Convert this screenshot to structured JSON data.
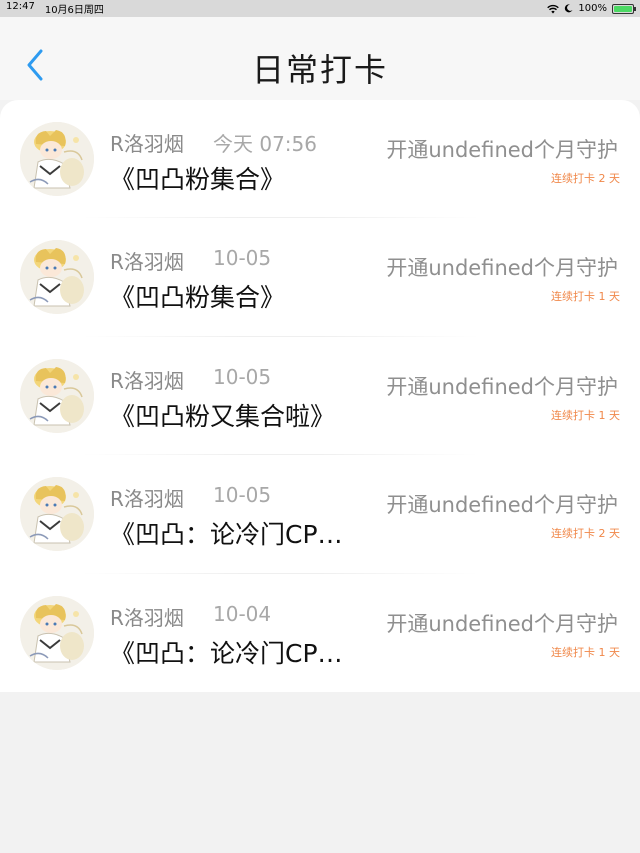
{
  "status_bar": {
    "time": "12:47",
    "date": "10月6日周四",
    "battery": "100%",
    "battery_level": 1.0
  },
  "header": {
    "title": "日常打卡"
  },
  "records": [
    {
      "name": "R洛羽烟",
      "time": "今天 07:56",
      "title": "《凹凸粉集合》",
      "guard": "开通undefined个月守护",
      "streak": "连续打卡 2 天"
    },
    {
      "name": "R洛羽烟",
      "time": "10-05",
      "title": "《凹凸粉集合》",
      "guard": "开通undefined个月守护",
      "streak": "连续打卡 1 天"
    },
    {
      "name": "R洛羽烟",
      "time": "10-05",
      "title": "《凹凸粉又集合啦》",
      "guard": "开通undefined个月守护",
      "streak": "连续打卡 1 天"
    },
    {
      "name": "R洛羽烟",
      "time": "10-05",
      "title": "《凹凸：论冷门CP…",
      "guard": "开通undefined个月守护",
      "streak": "连续打卡 2 天"
    },
    {
      "name": "R洛羽烟",
      "time": "10-04",
      "title": "《凹凸：论冷门CP…",
      "guard": "开通undefined个月守护",
      "streak": "连续打卡 1 天"
    }
  ]
}
